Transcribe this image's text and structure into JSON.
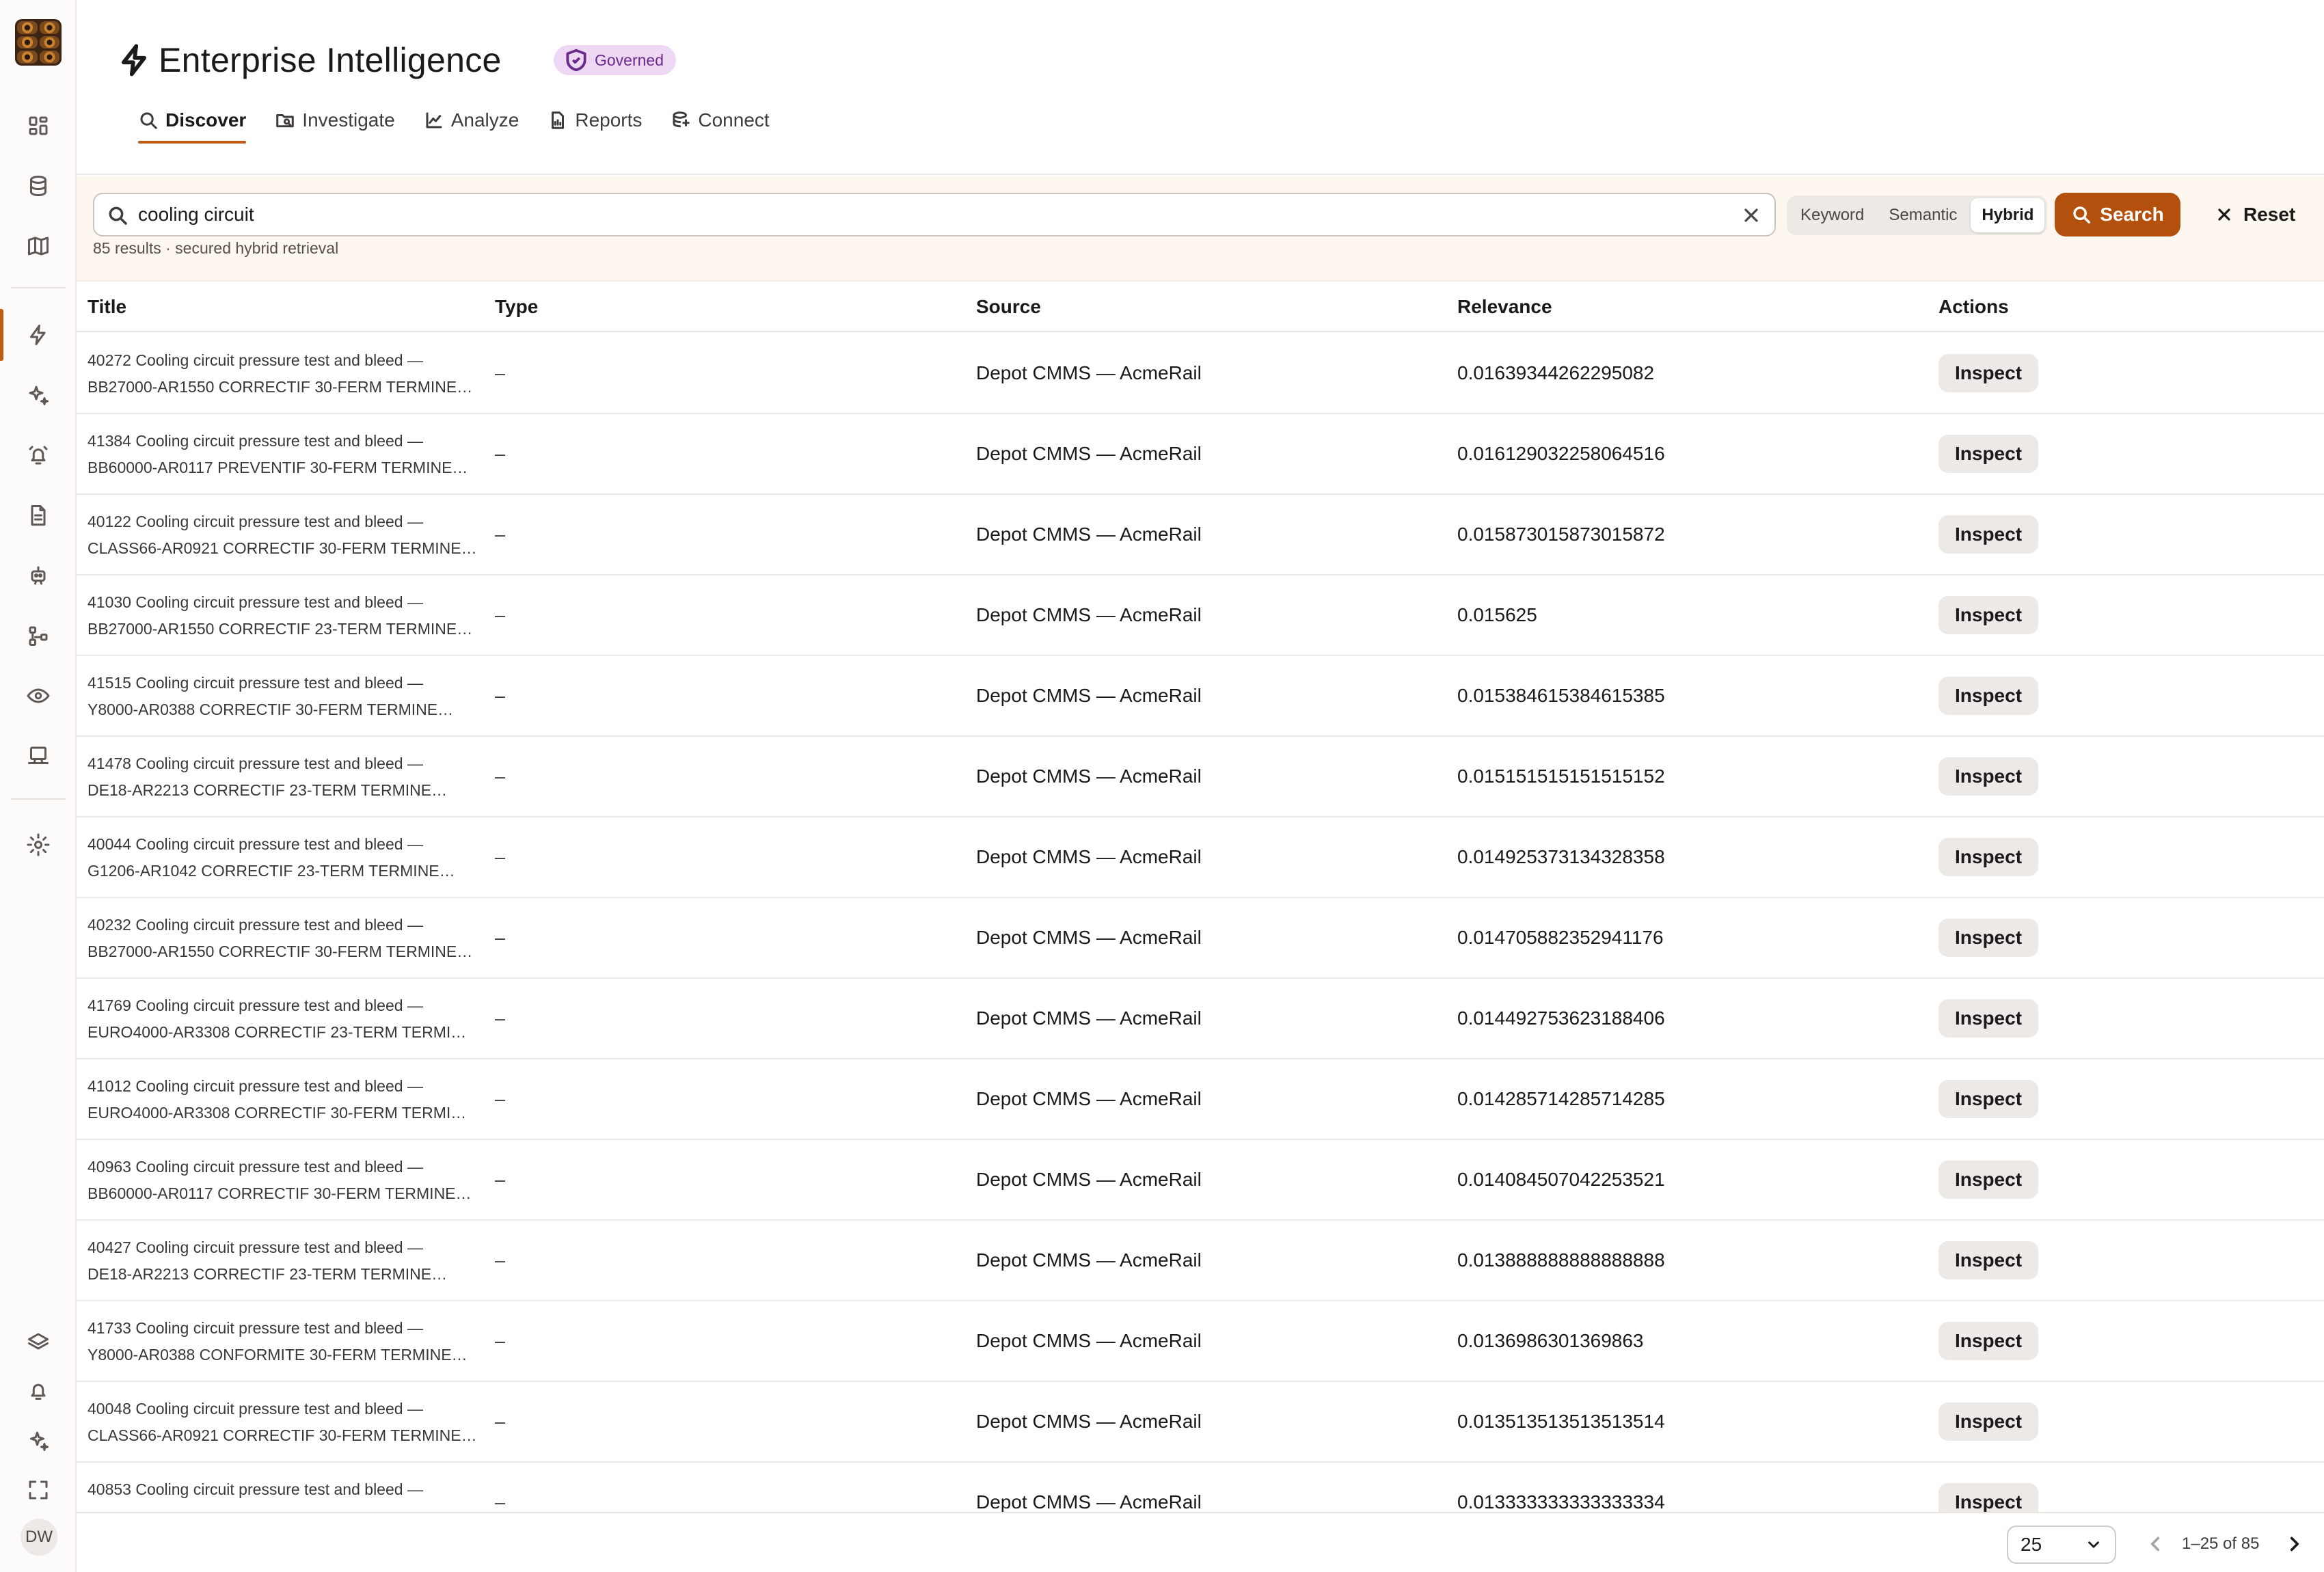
{
  "app": {
    "title": "Enterprise Intelligence",
    "badge": "Governed",
    "accent_color": "#b4500d",
    "badge_color": "#efd8f4"
  },
  "sidebar": {
    "top_icons": [
      "dashboard-icon",
      "database-icon",
      "map-icon"
    ],
    "middle_icons": [
      "bolt-icon",
      "sparkles-icon",
      "alarm-icon",
      "document-icon",
      "robot-icon",
      "workflow-icon",
      "eye-icon",
      "monitor-icon"
    ],
    "settings_icon": "gear-icon",
    "bottom_icons": [
      "layers-icon",
      "bell-icon",
      "sparkle-icon",
      "fullscreen-icon"
    ],
    "avatar_initials": "DW"
  },
  "tabs": [
    {
      "label": "Discover",
      "icon": "search-icon",
      "active": true
    },
    {
      "label": "Investigate",
      "icon": "folder-search-icon",
      "active": false
    },
    {
      "label": "Analyze",
      "icon": "chart-icon",
      "active": false
    },
    {
      "label": "Reports",
      "icon": "report-icon",
      "active": false
    },
    {
      "label": "Connect",
      "icon": "connect-icon",
      "active": false
    }
  ],
  "search": {
    "query": "cooling circuit",
    "results_meta": "85 results · secured hybrid retrieval",
    "modes": [
      "Keyword",
      "Semantic",
      "Hybrid"
    ],
    "active_mode": "Hybrid",
    "search_label": "Search",
    "reset_label": "Reset"
  },
  "table": {
    "columns": {
      "title": "Title",
      "type": "Type",
      "source": "Source",
      "relevance": "Relevance",
      "actions": "Actions"
    },
    "rows": [
      {
        "line1": "40272 Cooling circuit pressure test and bleed —",
        "line2": "BB27000-AR1550 CORRECTIF 30-FERM TERMINE…",
        "type": "–",
        "source": "Depot CMMS — AcmeRail",
        "relevance": "0.01639344262295082",
        "action": "Inspect"
      },
      {
        "line1": "41384 Cooling circuit pressure test and bleed —",
        "line2": "BB60000-AR0117 PREVENTIF 30-FERM TERMINE…",
        "type": "–",
        "source": "Depot CMMS — AcmeRail",
        "relevance": "0.016129032258064516",
        "action": "Inspect"
      },
      {
        "line1": "40122 Cooling circuit pressure test and bleed —",
        "line2": "CLASS66-AR0921 CORRECTIF 30-FERM TERMINE…",
        "type": "–",
        "source": "Depot CMMS — AcmeRail",
        "relevance": "0.015873015873015872",
        "action": "Inspect"
      },
      {
        "line1": "41030 Cooling circuit pressure test and bleed —",
        "line2": "BB27000-AR1550 CORRECTIF 23-TERM TERMINE…",
        "type": "–",
        "source": "Depot CMMS — AcmeRail",
        "relevance": "0.015625",
        "action": "Inspect"
      },
      {
        "line1": "41515 Cooling circuit pressure test and bleed —",
        "line2": "Y8000-AR0388 CORRECTIF 30-FERM TERMINE…",
        "type": "–",
        "source": "Depot CMMS — AcmeRail",
        "relevance": "0.015384615384615385",
        "action": "Inspect"
      },
      {
        "line1": "41478 Cooling circuit pressure test and bleed —",
        "line2": "DE18-AR2213 CORRECTIF 23-TERM TERMINE…",
        "type": "–",
        "source": "Depot CMMS — AcmeRail",
        "relevance": "0.015151515151515152",
        "action": "Inspect"
      },
      {
        "line1": "40044 Cooling circuit pressure test and bleed —",
        "line2": "G1206-AR1042 CORRECTIF 23-TERM TERMINE…",
        "type": "–",
        "source": "Depot CMMS — AcmeRail",
        "relevance": "0.014925373134328358",
        "action": "Inspect"
      },
      {
        "line1": "40232 Cooling circuit pressure test and bleed —",
        "line2": "BB27000-AR1550 CORRECTIF 30-FERM TERMINE…",
        "type": "–",
        "source": "Depot CMMS — AcmeRail",
        "relevance": "0.014705882352941176",
        "action": "Inspect"
      },
      {
        "line1": "41769 Cooling circuit pressure test and bleed —",
        "line2": "EURO4000-AR3308 CORRECTIF 23-TERM TERMI…",
        "type": "–",
        "source": "Depot CMMS — AcmeRail",
        "relevance": "0.014492753623188406",
        "action": "Inspect"
      },
      {
        "line1": "41012 Cooling circuit pressure test and bleed —",
        "line2": "EURO4000-AR3308 CORRECTIF 30-FERM TERMI…",
        "type": "–",
        "source": "Depot CMMS — AcmeRail",
        "relevance": "0.014285714285714285",
        "action": "Inspect"
      },
      {
        "line1": "40963 Cooling circuit pressure test and bleed —",
        "line2": "BB60000-AR0117 CORRECTIF 30-FERM TERMINE…",
        "type": "–",
        "source": "Depot CMMS — AcmeRail",
        "relevance": "0.014084507042253521",
        "action": "Inspect"
      },
      {
        "line1": "40427 Cooling circuit pressure test and bleed —",
        "line2": "DE18-AR2213 CORRECTIF 23-TERM TERMINE…",
        "type": "–",
        "source": "Depot CMMS — AcmeRail",
        "relevance": "0.013888888888888888",
        "action": "Inspect"
      },
      {
        "line1": "41733 Cooling circuit pressure test and bleed —",
        "line2": "Y8000-AR0388 CONFORMITE 30-FERM TERMINE…",
        "type": "–",
        "source": "Depot CMMS — AcmeRail",
        "relevance": "0.0136986301369863",
        "action": "Inspect"
      },
      {
        "line1": "40048 Cooling circuit pressure test and bleed —",
        "line2": "CLASS66-AR0921 CORRECTIF 30-FERM TERMINE…",
        "type": "–",
        "source": "Depot CMMS — AcmeRail",
        "relevance": "0.013513513513513514",
        "action": "Inspect"
      },
      {
        "line1": "40853 Cooling circuit pressure test and bleed —",
        "line2": "",
        "type": "–",
        "source": "Depot CMMS — AcmeRail",
        "relevance": "0.013333333333333334",
        "action": "Inspect"
      }
    ]
  },
  "pagination": {
    "page_size": "25",
    "range": "1–25 of 85"
  }
}
